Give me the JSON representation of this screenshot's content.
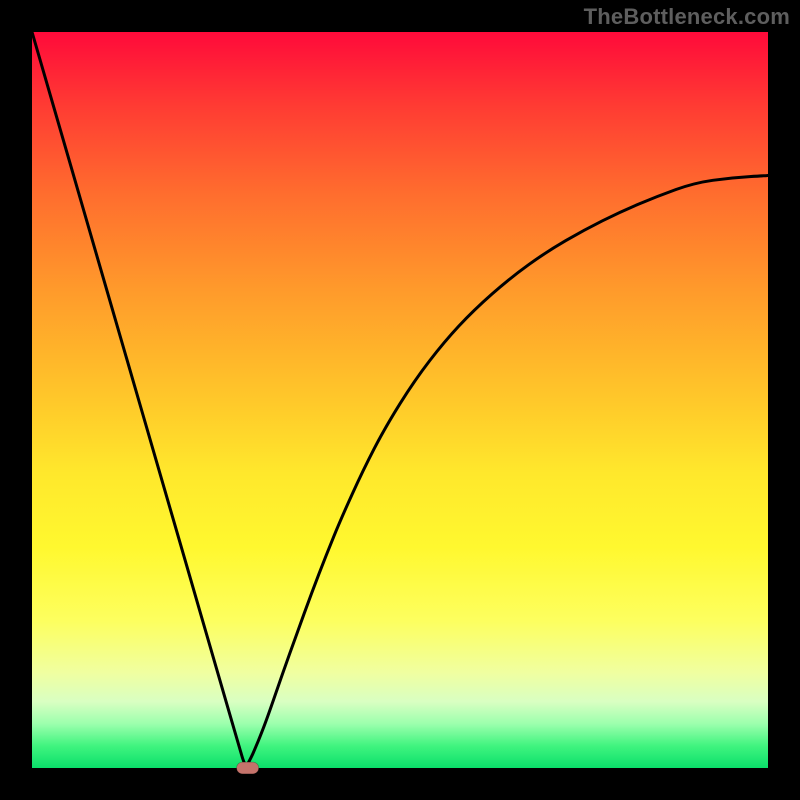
{
  "watermark_text": "TheBottleneck.com",
  "chart_data": {
    "type": "line",
    "title": "",
    "xlabel": "",
    "ylabel": "",
    "x_range": [
      0,
      100
    ],
    "y_range": [
      0,
      100
    ],
    "ylim": [
      0,
      100
    ],
    "x": [
      0,
      2,
      4,
      6,
      8,
      10,
      12,
      14,
      16,
      18,
      20,
      22,
      24,
      26,
      28,
      29,
      29.5,
      30,
      30.5,
      31,
      32,
      34,
      36,
      38,
      40,
      42,
      45,
      48,
      52,
      56,
      60,
      65,
      70,
      75,
      80,
      85,
      90,
      95,
      100
    ],
    "values": [
      100,
      93.1,
      86.2,
      79.3,
      72.4,
      65.5,
      58.6,
      51.7,
      44.8,
      37.9,
      31.0,
      24.1,
      17.2,
      10.3,
      3.4,
      0.0,
      0.9,
      1.9,
      3.1,
      4.3,
      6.9,
      12.7,
      18.3,
      23.8,
      29.0,
      33.9,
      40.5,
      46.3,
      52.7,
      57.9,
      62.2,
      66.6,
      70.2,
      73.1,
      75.6,
      77.7,
      79.5,
      80.2,
      80.5
    ],
    "sweet_spot": {
      "x": 29.3,
      "y": 0,
      "width_pct": 3.0,
      "height_pct": 1.6
    },
    "annotations": [],
    "legend": [],
    "grid": false
  },
  "colors": {
    "frame": "#000000",
    "curve": "#000000",
    "pill": "#c5736b",
    "watermark": "#5e5e5e"
  }
}
